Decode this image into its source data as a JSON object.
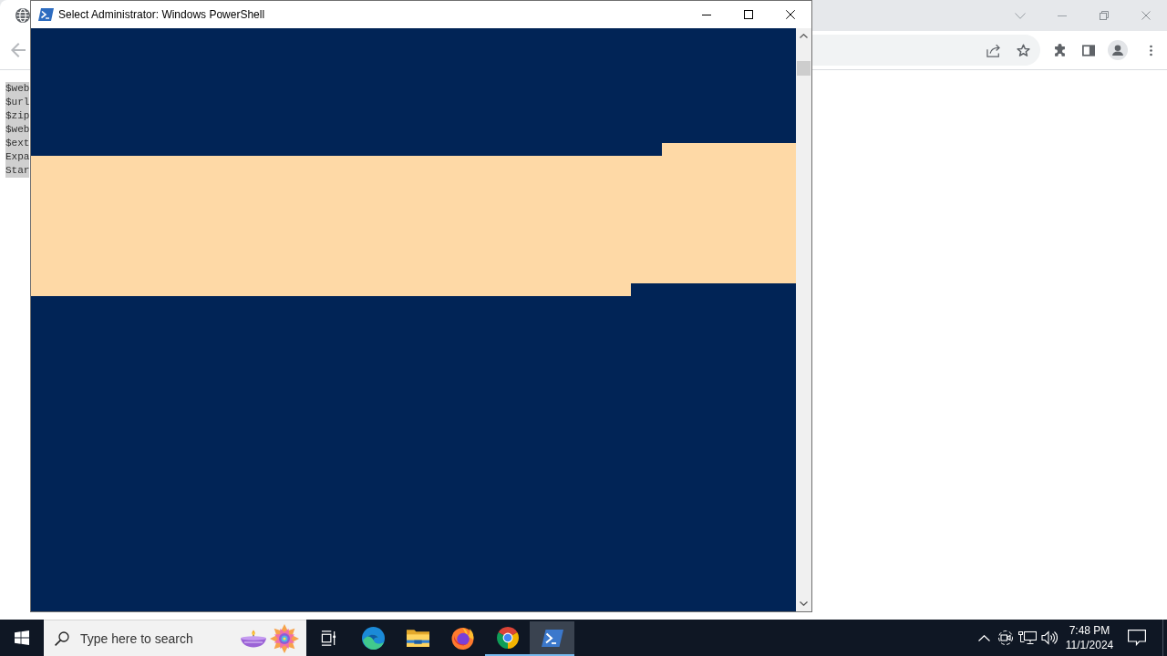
{
  "browser": {
    "back_button": {
      "disabled": true
    },
    "page_lines": [
      {
        "text": "$web",
        "selected": true
      },
      {
        "text": "$url",
        "selected": true
      },
      {
        "text": "$zip",
        "selected": true
      },
      {
        "text": "$web",
        "selected": true
      },
      {
        "text": "$ext",
        "selected": true
      },
      {
        "text": "Expa",
        "selected": true
      },
      {
        "text": "Star",
        "selected": true
      }
    ]
  },
  "powershell": {
    "title": "Select Administrator: Windows PowerShell",
    "console": {
      "selection_active": true
    }
  },
  "taskbar": {
    "search": {
      "placeholder": "Type here to search"
    },
    "apps": [
      {
        "kind": "edge",
        "running": false,
        "selected": false
      },
      {
        "kind": "explorer",
        "running": false,
        "selected": false
      },
      {
        "kind": "firefox",
        "running": false,
        "selected": false
      },
      {
        "kind": "chrome",
        "running": true,
        "selected": false
      },
      {
        "kind": "powershell",
        "running": true,
        "selected": true
      }
    ],
    "clock": {
      "time": "7:48 PM",
      "date": "11/1/2024"
    }
  }
}
